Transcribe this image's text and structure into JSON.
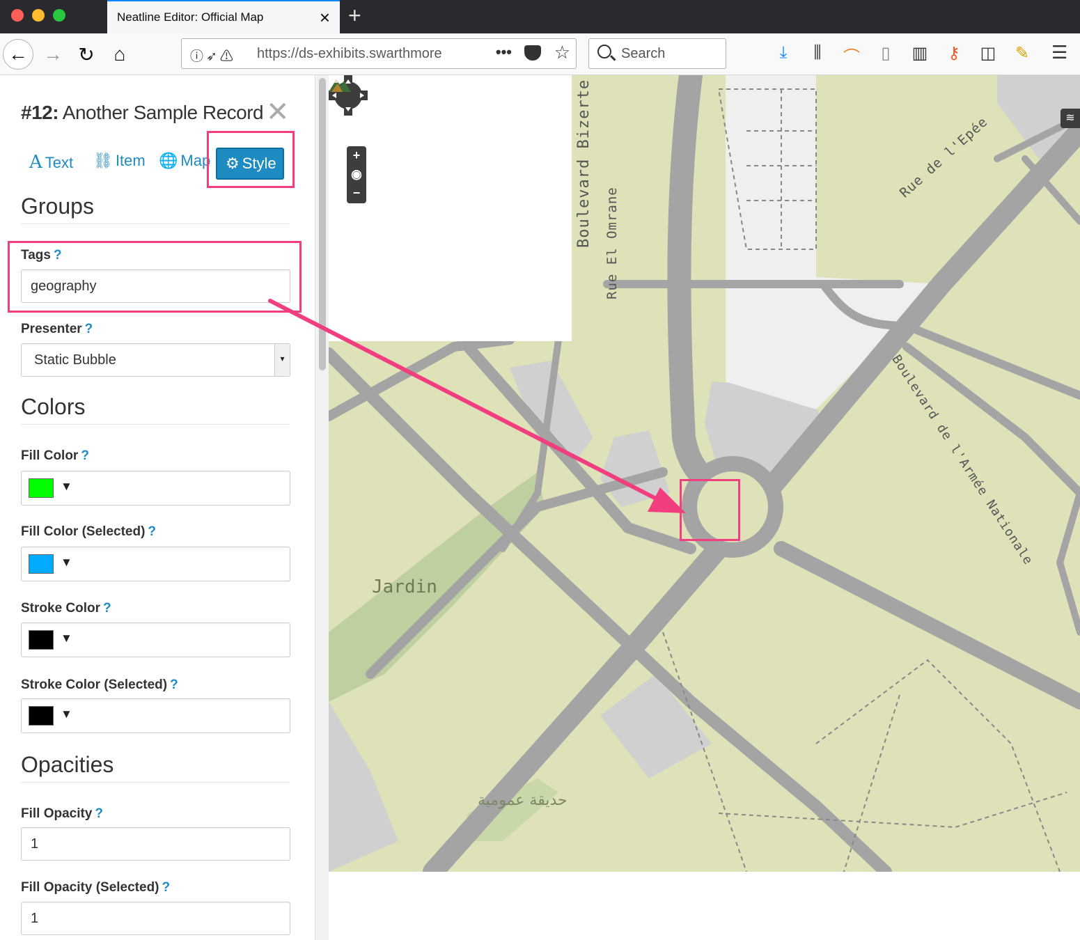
{
  "browser": {
    "tab_title": "Neatline Editor: Official Map",
    "url": "https://ds-exhibits.swarthmore",
    "search_placeholder": "Search"
  },
  "editor": {
    "record_number": "#12:",
    "record_title": "Another Sample Record",
    "tabs": [
      {
        "label": "Text",
        "icon": "text-icon"
      },
      {
        "label": "Item",
        "icon": "link-icon"
      },
      {
        "label": "Map",
        "icon": "globe-icon"
      },
      {
        "label": "Style",
        "icon": "gear-icon",
        "active": true
      }
    ],
    "sections": {
      "groups": "Groups",
      "colors": "Colors",
      "opacities": "Opacities"
    },
    "fields": {
      "tags": {
        "label": "Tags",
        "help": "?",
        "value": "geography"
      },
      "presenter": {
        "label": "Presenter",
        "help": "?",
        "value": "Static Bubble"
      },
      "fill_color": {
        "label": "Fill Color",
        "help": "?",
        "color": "#00ff00"
      },
      "fill_color_selected": {
        "label": "Fill Color (Selected)",
        "help": "?",
        "color": "#00aaff"
      },
      "stroke_color": {
        "label": "Stroke Color",
        "help": "?",
        "color": "#000000"
      },
      "stroke_color_selected": {
        "label": "Stroke Color (Selected)",
        "help": "?",
        "color": "#000000"
      },
      "fill_opacity": {
        "label": "Fill Opacity",
        "help": "?",
        "value": "1"
      },
      "fill_opacity_selected": {
        "label": "Fill Opacity (Selected)",
        "help": "?",
        "value": "1"
      }
    }
  },
  "map": {
    "labels": {
      "jardin": "Jardin",
      "arabic": "حديقة عمومية",
      "bizerte": "Boulevard Bizerte",
      "omrane": "Rue El Omrane",
      "epee": "Rue de l'Epée",
      "armee": "Boulevard de l'Armée Nationale"
    },
    "controls": {
      "zoom_in": "+",
      "zoom_out": "−"
    }
  },
  "colors": {
    "highlight": "#f03e7f",
    "accent": "#1e8bc3",
    "map_land": "#dfe1b9",
    "map_road": "#a0a0a0"
  }
}
